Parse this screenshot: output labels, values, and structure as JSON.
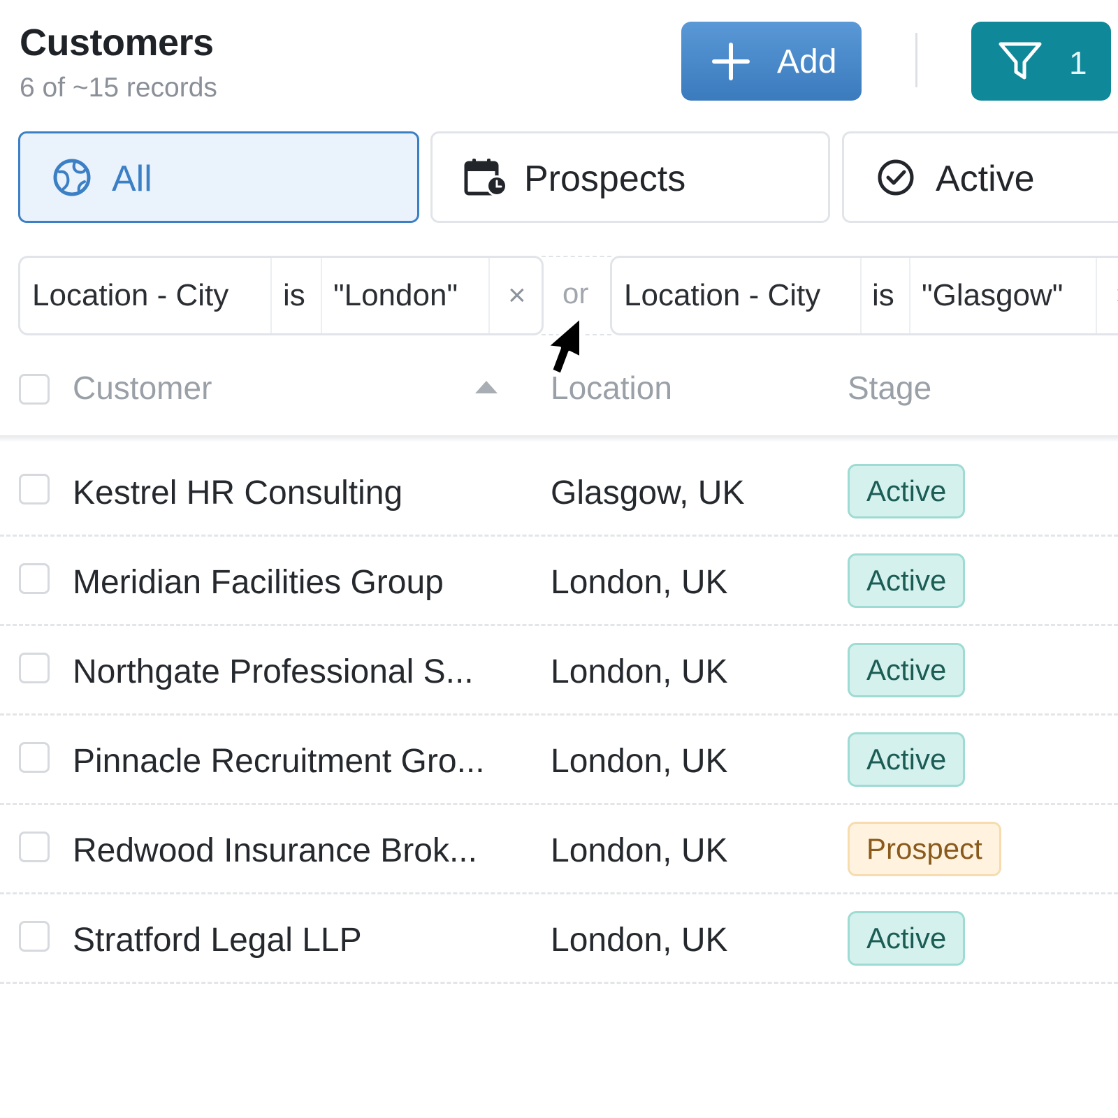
{
  "header": {
    "title": "Customers",
    "subtitle": "6 of ~15 records",
    "add_label": "Add",
    "filter_count": "1"
  },
  "tabs": [
    {
      "label": "All",
      "icon": "globe-icon",
      "selected": true
    },
    {
      "label": "Prospects",
      "icon": "calendar-clock-icon",
      "selected": false
    },
    {
      "label": "Active",
      "icon": "check-circle-icon",
      "selected": false
    }
  ],
  "filters": {
    "conjunction": "or",
    "chips": [
      {
        "field": "Location - City",
        "operator": "is",
        "value": "\"London\""
      },
      {
        "field": "Location - City",
        "operator": "is",
        "value": "\"Glasgow\""
      }
    ]
  },
  "table": {
    "columns": [
      "Customer",
      "Location",
      "Stage"
    ],
    "sort": {
      "column": "Customer",
      "direction": "ascending"
    },
    "rows": [
      {
        "customer": "Kestrel HR Consulting",
        "location": "Glasgow, UK",
        "stage": "Active"
      },
      {
        "customer": "Meridian Facilities Group",
        "location": "London, UK",
        "stage": "Active"
      },
      {
        "customer": "Northgate Professional S...",
        "location": "London, UK",
        "stage": "Active"
      },
      {
        "customer": "Pinnacle Recruitment Gro...",
        "location": "London, UK",
        "stage": "Active"
      },
      {
        "customer": "Redwood Insurance Brok...",
        "location": "London, UK",
        "stage": "Prospect"
      },
      {
        "customer": "Stratford Legal LLP",
        "location": "London, UK",
        "stage": "Active"
      }
    ]
  },
  "colors": {
    "primary_button": "#3f82c5",
    "filter_button": "#0f8899",
    "active_badge_bg": "#d5f1ee",
    "prospect_badge_bg": "#fff3e0"
  }
}
